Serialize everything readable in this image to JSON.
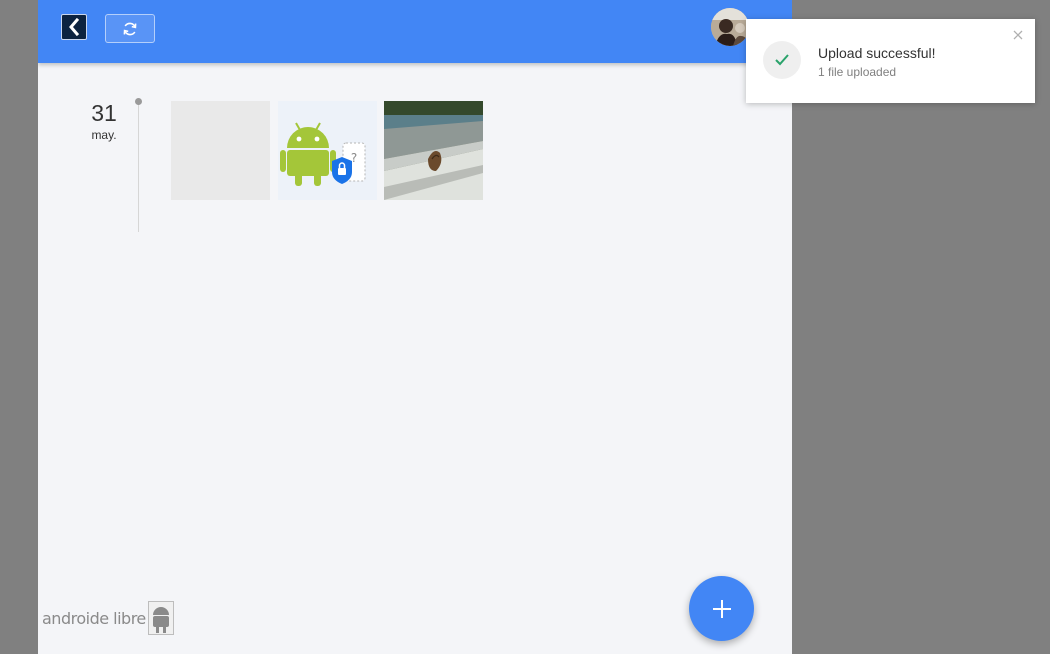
{
  "timeline": {
    "day": "31",
    "month": "may."
  },
  "icons": {
    "back": "chevron-left-icon",
    "refresh": "refresh-icon",
    "add": "plus-icon",
    "check": "check-icon",
    "close": "close-icon"
  },
  "watermark": {
    "text": "androide libre"
  },
  "toast": {
    "title": "Upload successful!",
    "subtitle": "1 file uploaded"
  },
  "colors": {
    "accent": "#4286f5",
    "success": "#2aa36b",
    "android_green": "#a4c639"
  }
}
